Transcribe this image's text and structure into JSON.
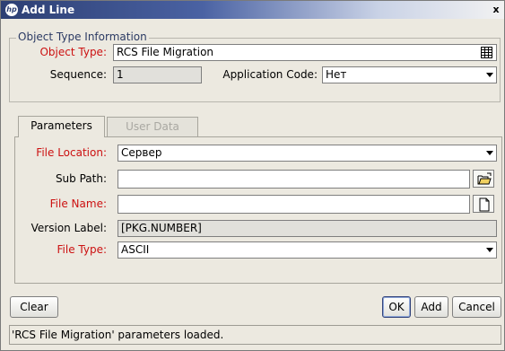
{
  "window": {
    "title": "Add Line",
    "logo_text": "hp",
    "close_label": "x"
  },
  "object_type_info": {
    "group_title": "Object Type Information",
    "object_type_label": "Object Type:",
    "object_type_value": "RCS File Migration",
    "sequence_label": "Sequence:",
    "sequence_value": "1",
    "application_code_label": "Application Code:",
    "application_code_value": "Нет"
  },
  "tabs": [
    {
      "label": "Parameters",
      "active": true
    },
    {
      "label": "User Data",
      "active": false
    }
  ],
  "parameters": {
    "file_location_label": "File Location:",
    "file_location_value": "Сервер",
    "sub_path_label": "Sub Path:",
    "sub_path_value": "",
    "file_name_label": "File Name:",
    "file_name_value": "",
    "version_label_label": "Version Label:",
    "version_label_value": "[PKG.NUMBER]",
    "file_type_label": "File Type:",
    "file_type_value": "ASCII"
  },
  "buttons": {
    "clear": "Clear",
    "ok": "OK",
    "add": "Add",
    "cancel": "Cancel"
  },
  "status": {
    "message": "'RCS File Migration' parameters loaded."
  },
  "colors": {
    "required_label": "#cc1111",
    "title_bar": "#2d3f73",
    "background": "#ece9e0"
  }
}
